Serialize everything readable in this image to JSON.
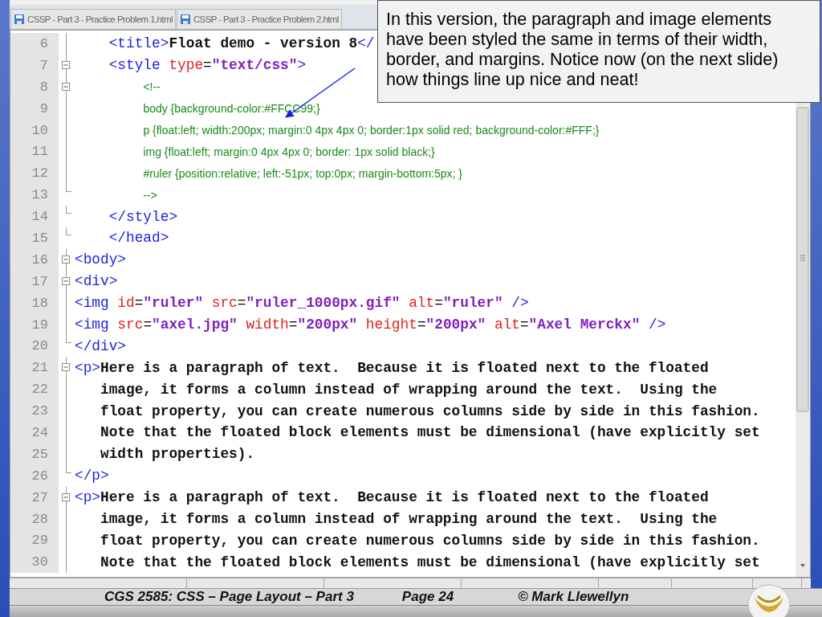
{
  "tabs": [
    {
      "label": "CSSP - Part 3 - Practice Problem 1.html",
      "selected": false
    },
    {
      "label": "CSSP - Part 3 - Practice Problem 2.html",
      "selected": false
    }
  ],
  "editor": {
    "lines": [
      {
        "number": "6",
        "kind": "inside",
        "tokens": [
          {
            "kind": "tag",
            "text": "    <title>"
          },
          {
            "kind": "text",
            "text": "Float demo - version 8"
          },
          {
            "kind": "tag",
            "text": "</"
          }
        ]
      },
      {
        "number": "7",
        "kind": "open",
        "tokens": [
          {
            "kind": "tag",
            "text": "    <style"
          },
          {
            "kind": "attr",
            "text": " type"
          },
          {
            "kind": "eq",
            "text": "="
          },
          {
            "kind": "value",
            "text": "\"text/css\""
          },
          {
            "kind": "tag",
            "text": ">"
          }
        ]
      },
      {
        "number": "8",
        "kind": "open",
        "tokens": [
          {
            "kind": "css",
            "text": "        <!--"
          }
        ]
      },
      {
        "number": "9",
        "kind": "inside",
        "tokens": [
          {
            "kind": "css",
            "text": "        body {background-color:#FFCC99;}"
          }
        ]
      },
      {
        "number": "10",
        "kind": "inside",
        "tokens": [
          {
            "kind": "css",
            "text": "        p {float:left; width:200px; margin:0 4px 4px 0; border:1px solid red; background-color:#FFF;}"
          }
        ]
      },
      {
        "number": "11",
        "kind": "inside",
        "tokens": [
          {
            "kind": "css",
            "text": "        img {float:left; margin:0 4px 4px 0; border: 1px solid black;}"
          }
        ]
      },
      {
        "number": "12",
        "kind": "inside",
        "tokens": [
          {
            "kind": "css",
            "text": "        #ruler {position:relative; left:-51px; top:0px; margin-bottom:5px; }"
          }
        ]
      },
      {
        "number": "13",
        "kind": "close",
        "tokens": [
          {
            "kind": "css",
            "text": "        -->"
          }
        ]
      },
      {
        "number": "14",
        "kind": "close",
        "tokens": [
          {
            "kind": "tag",
            "text": "    </style>"
          }
        ]
      },
      {
        "number": "15",
        "kind": "close",
        "tokens": [
          {
            "kind": "tag",
            "text": "    </head>"
          }
        ]
      },
      {
        "number": "16",
        "kind": "open",
        "tokens": [
          {
            "kind": "tag",
            "text": "<body>"
          }
        ]
      },
      {
        "number": "17",
        "kind": "open",
        "tokens": [
          {
            "kind": "tag",
            "text": "<div>"
          }
        ]
      },
      {
        "number": "18",
        "kind": "inside",
        "tokens": [
          {
            "kind": "tag",
            "text": "<img"
          },
          {
            "kind": "attr",
            "text": " id"
          },
          {
            "kind": "eq",
            "text": "="
          },
          {
            "kind": "value",
            "text": "\"ruler\""
          },
          {
            "kind": "attr",
            "text": " src"
          },
          {
            "kind": "eq",
            "text": "="
          },
          {
            "kind": "value",
            "text": "\"ruler_1000px.gif\""
          },
          {
            "kind": "attr",
            "text": " alt"
          },
          {
            "kind": "eq",
            "text": "="
          },
          {
            "kind": "value",
            "text": "\"ruler\""
          },
          {
            "kind": "tag",
            "text": " />"
          }
        ]
      },
      {
        "number": "19",
        "kind": "inside",
        "tokens": [
          {
            "kind": "tag",
            "text": "<img"
          },
          {
            "kind": "attr",
            "text": " src"
          },
          {
            "kind": "eq",
            "text": "="
          },
          {
            "kind": "value",
            "text": "\"axel.jpg\""
          },
          {
            "kind": "attr",
            "text": " width"
          },
          {
            "kind": "eq",
            "text": "="
          },
          {
            "kind": "value",
            "text": "\"200px\""
          },
          {
            "kind": "attr",
            "text": " height"
          },
          {
            "kind": "eq",
            "text": "="
          },
          {
            "kind": "value",
            "text": "\"200px\""
          },
          {
            "kind": "attr",
            "text": " alt"
          },
          {
            "kind": "eq",
            "text": "="
          },
          {
            "kind": "value",
            "text": "\"Axel Merckx\""
          },
          {
            "kind": "tag",
            "text": " />"
          }
        ]
      },
      {
        "number": "20",
        "kind": "close",
        "tokens": [
          {
            "kind": "tag",
            "text": "</div>"
          }
        ]
      },
      {
        "number": "21",
        "kind": "open",
        "tokens": [
          {
            "kind": "tag",
            "text": "<p>"
          },
          {
            "kind": "text",
            "text": "Here is a paragraph of text.  Because it is floated next to the floated"
          }
        ]
      },
      {
        "number": "22",
        "kind": "inside",
        "tokens": [
          {
            "kind": "text",
            "text": "   image, it forms a column instead of wrapping around the text.  Using the"
          }
        ]
      },
      {
        "number": "23",
        "kind": "inside",
        "tokens": [
          {
            "kind": "text",
            "text": "   float property, you can create numerous columns side by side in this fashion."
          }
        ]
      },
      {
        "number": "24",
        "kind": "inside",
        "tokens": [
          {
            "kind": "text",
            "text": "   Note that the floated block elements must be dimensional (have explicitly set"
          }
        ]
      },
      {
        "number": "25",
        "kind": "inside",
        "tokens": [
          {
            "kind": "text",
            "text": "   width properties)."
          }
        ]
      },
      {
        "number": "26",
        "kind": "close",
        "tokens": [
          {
            "kind": "tag",
            "text": "</p>"
          }
        ]
      },
      {
        "number": "27",
        "kind": "open",
        "tokens": [
          {
            "kind": "tag",
            "text": "<p>"
          },
          {
            "kind": "text",
            "text": "Here is a paragraph of text.  Because it is floated next to the floated"
          }
        ]
      },
      {
        "number": "28",
        "kind": "inside",
        "tokens": [
          {
            "kind": "text",
            "text": "   image, it forms a column instead of wrapping around the text.  Using the"
          }
        ]
      },
      {
        "number": "29",
        "kind": "inside",
        "tokens": [
          {
            "kind": "text",
            "text": "   float property, you can create numerous columns side by side in this fashion."
          }
        ]
      },
      {
        "number": "30",
        "kind": "inside",
        "tokens": [
          {
            "kind": "text",
            "text": "   Note that the floated block elements must be dimensional (have explicitly set"
          }
        ]
      }
    ]
  },
  "callout": {
    "text": "In this version, the paragraph and image elements have been styled the same in terms of their width, border, and margins.  Notice now (on the next slide) how things line up nice and neat!"
  },
  "footer": {
    "course": "CGS 2585: CSS – Page Layout – Part 3",
    "page": "Page 24",
    "author": "© Mark Llewellyn"
  }
}
